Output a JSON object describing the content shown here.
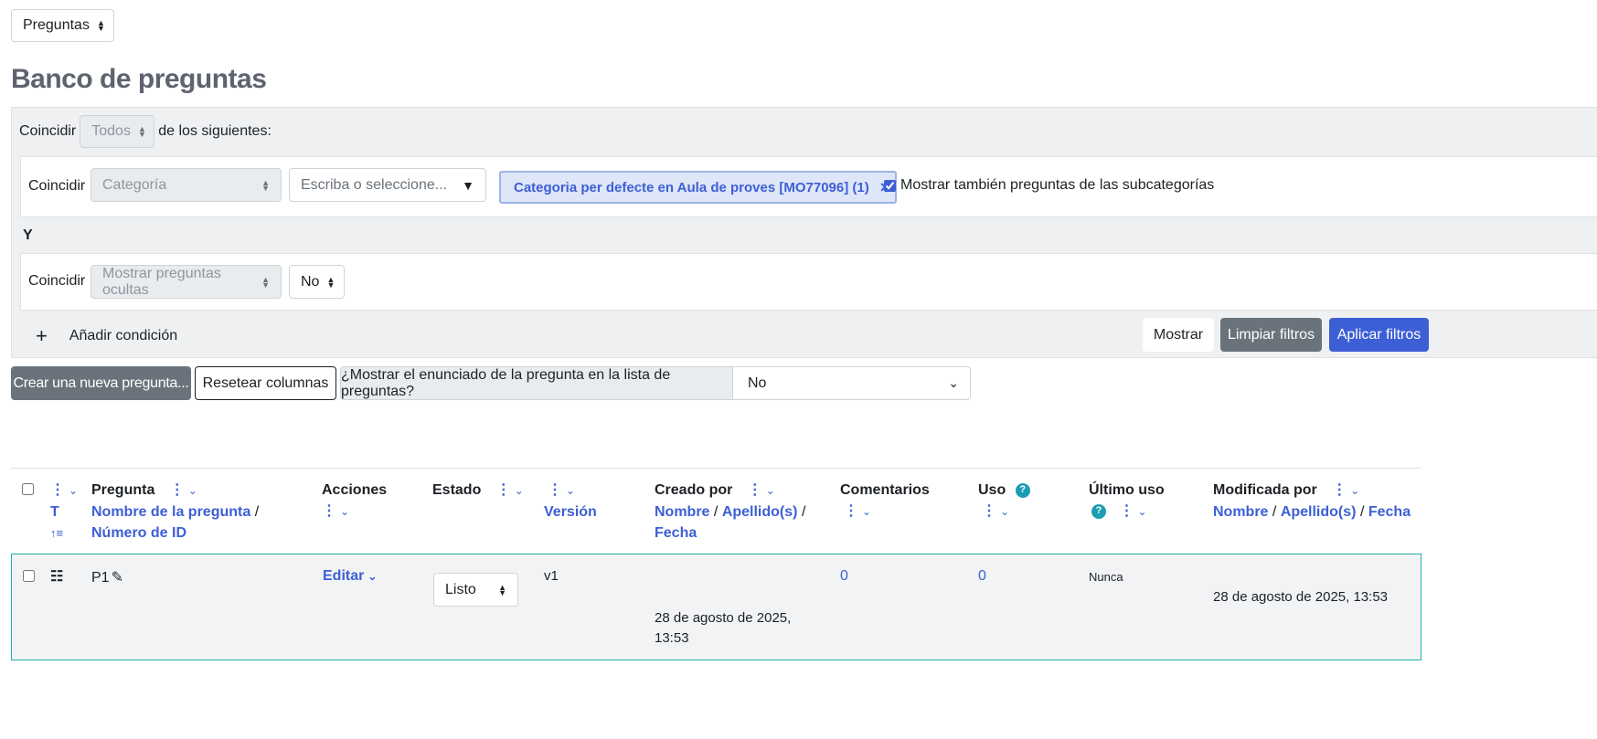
{
  "top_select": {
    "value": "Preguntas"
  },
  "page_title": "Banco de preguntas",
  "filters": {
    "match_label": "Coincidir",
    "match_all_value": "Todos",
    "of_following": "de los siguientes:",
    "condition1": {
      "match_label": "Coincidir",
      "type": "Categoría",
      "search_placeholder": "Escriba o seleccione...",
      "chip_label": "Categoria per defecte en Aula de proves [MO77096] (1)",
      "chip_remove": "×",
      "subcat_checkbox_label": "Mostrar también preguntas de las subcategorías",
      "subcat_checked": true
    },
    "joiner": "Y",
    "condition2": {
      "match_label": "Coincidir",
      "type": "Mostrar preguntas ocultas",
      "value": "No"
    },
    "add_condition": "Añadir condición",
    "add_icon": "+",
    "show_button": "Mostrar",
    "clear_button": "Limpiar filtros",
    "apply_button": "Aplicar filtros"
  },
  "toolbar": {
    "create_button": "Crear una nueva pregunta...",
    "reset_columns": "Resetear columnas",
    "show_text_label": "¿Mostrar el enunciado de la pregunta en la lista de preguntas?",
    "show_text_value": "No"
  },
  "table": {
    "headers": {
      "type_sort_t": "T",
      "type_sort_icon": "↑≡",
      "question": "Pregunta",
      "question_name": "Nombre de la pregunta",
      "id_number": "Número de ID",
      "actions": "Acciones",
      "status": "Estado",
      "version": "Versión",
      "created_by": "Creado por",
      "first_name": "Nombre",
      "last_name": "Apellido(s)",
      "date": "Fecha",
      "comments": "Comentarios",
      "usage": "Uso",
      "last_used": "Último uso",
      "modified_by": "Modificada por",
      "mod_first_name": "Nombre",
      "mod_last_name": "Apellido(s)",
      "mod_date": "Fecha",
      "separator": "/"
    },
    "rows": [
      {
        "name": "P1",
        "edit": "Editar",
        "status": "Listo",
        "version": "v1",
        "created_date": "28 de agosto de 2025,",
        "created_time": "13:53",
        "comments": "0",
        "usage": "0",
        "last_used": "Nunca",
        "modified": "28 de agosto de 2025, 13:53"
      }
    ]
  },
  "colors": {
    "primary": "#3d5fd6",
    "secondary": "#6a737b",
    "title": "#5f6370",
    "filter_bg": "#eef0f2",
    "row_bg": "#f2f3f5",
    "row_border": "#1ab3a6",
    "help": "#1c9db2"
  }
}
